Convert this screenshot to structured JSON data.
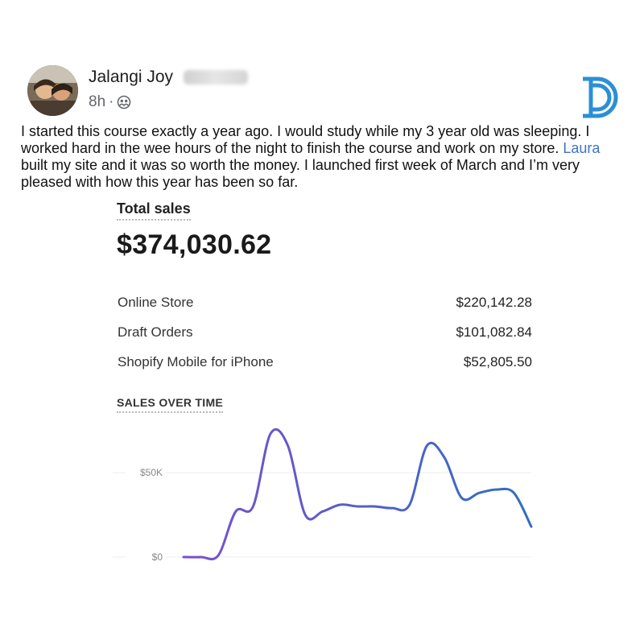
{
  "post": {
    "author": "Jalangi Joy",
    "time": "8h",
    "audience_icon": "friends-icon",
    "text_before_link": "I started this course exactly a year ago. I would study while my 3 year old was sleeping. I worked hard in the wee hours of the night to finish the course and work on my store. ",
    "link_text": "Laura",
    "text_after_link": " built my site and it was so worth the money. I launched first week of March and I’m very pleased with how this year has been so far.",
    "link_color": "#3b73c8"
  },
  "brand_logo": {
    "icon": "d-logo-icon",
    "color": "#2b8fd6"
  },
  "sales": {
    "title": "Total sales",
    "total": "$374,030.62",
    "breakdown": [
      {
        "label": "Online Store",
        "value": "$220,142.28"
      },
      {
        "label": "Draft Orders",
        "value": "$101,082.84"
      },
      {
        "label": "Shopify Mobile for iPhone",
        "value": "$52,805.50"
      }
    ]
  },
  "chart_data": {
    "type": "line",
    "title": "SALES OVER TIME",
    "y_ticks": [
      "$50K",
      "$0"
    ],
    "y_tick_values": [
      50000,
      0
    ],
    "ylim": [
      0,
      82000
    ],
    "grid": true,
    "series": [
      {
        "values": [
          0,
          0,
          1000,
          27000,
          30000,
          73000,
          66000,
          25000,
          27000,
          31000,
          30000,
          30000,
          29000,
          31000,
          66000,
          59000,
          35000,
          38000,
          40000,
          38000,
          18000
        ],
        "color_start": "#7a4fd0",
        "color_end": "#2f6fbf"
      }
    ]
  }
}
